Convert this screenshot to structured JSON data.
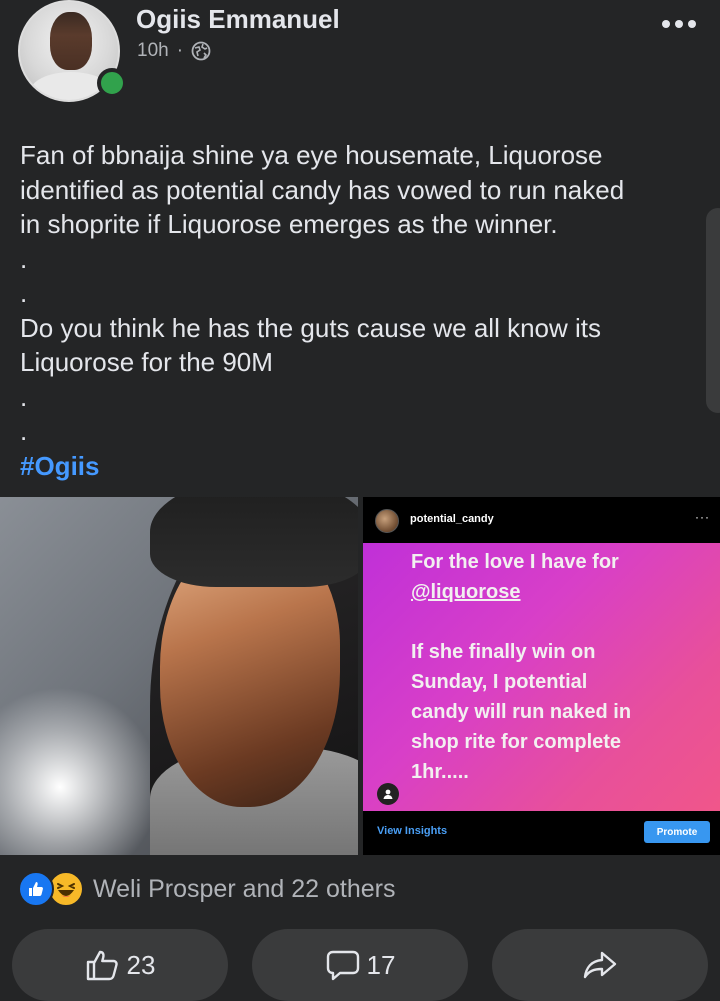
{
  "post": {
    "author": "Ogiis Emmanuel",
    "time": "10h",
    "separator": "·",
    "privacy_icon": "globe-icon",
    "body_lines": [
      "Fan of bbnaija shine ya eye housemate, Liquorose",
      "identified as potential candy has vowed to run naked",
      "in shoprite if Liquorose emerges as the winner.",
      ".",
      ".",
      "Do you think he has the guts cause we all know its",
      "Liquorose for the 90M",
      ".",
      "."
    ],
    "hashtag": "#Ogiis"
  },
  "instagram": {
    "username": "potential_candy",
    "more": "···",
    "story_lines": [
      "For the love I have for",
      "@liquorose",
      "",
      "If she finally win on",
      "Sunday, I potential",
      "candy will run naked in",
      "shop rite for complete",
      "1hr....."
    ],
    "view_insights": "View Insights",
    "promote": "Promote"
  },
  "reactions": {
    "icons": [
      "like-icon",
      "haha-icon"
    ],
    "summary": "Weli Prosper and 22 others"
  },
  "actions": {
    "like_count": "23",
    "comment_count": "17"
  },
  "colors": {
    "background": "#242526",
    "button": "#3a3b3c",
    "hashtag": "#4599ff",
    "online": "#31a24c",
    "like": "#1877f2"
  }
}
